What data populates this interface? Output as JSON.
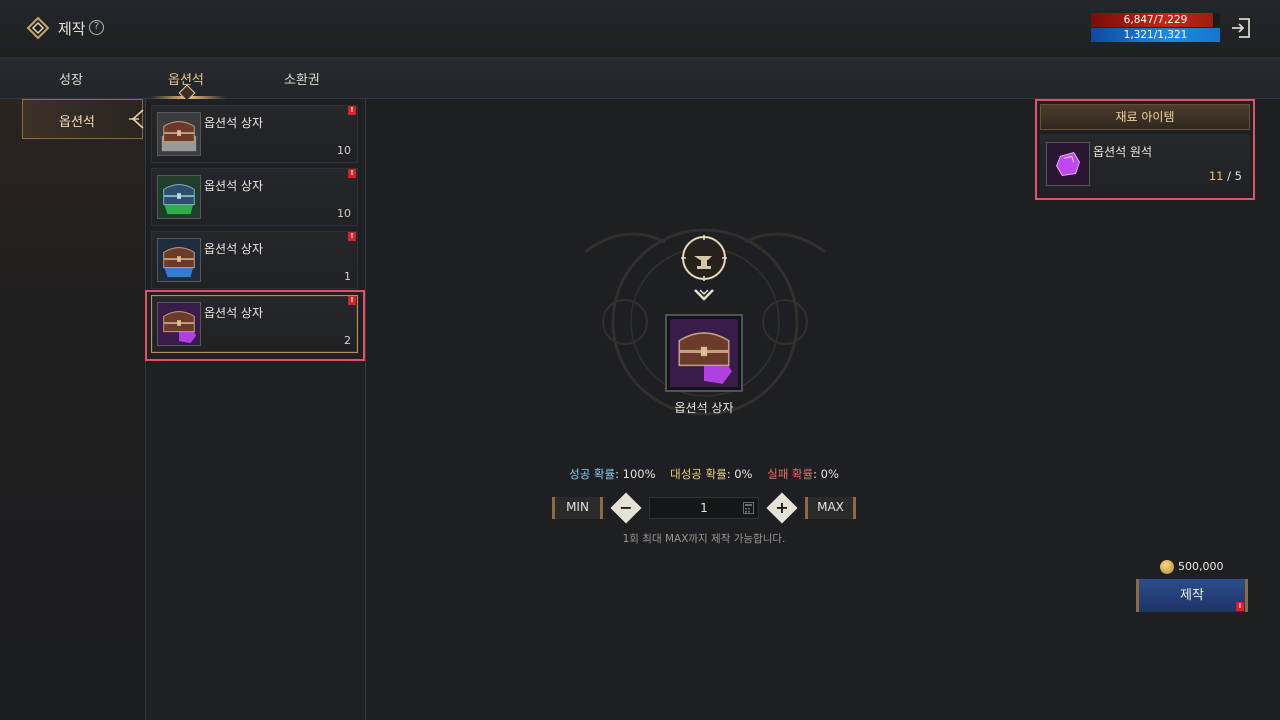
{
  "header": {
    "title": "제작",
    "help_glyph": "?",
    "hp_text": "6,847/7,229",
    "hp_fraction": 0.947,
    "mp_text": "1,321/1,321",
    "mp_fraction": 1.0,
    "icons": [
      "back-diamond-icon",
      "help-icon",
      "exit-icon"
    ]
  },
  "tabs": [
    {
      "label": "성장",
      "active": false
    },
    {
      "label": "옵션석",
      "active": true
    },
    {
      "label": "소환권",
      "active": false
    }
  ],
  "category": {
    "label": "옵션석",
    "selected": true
  },
  "list": {
    "items": [
      {
        "name": "옵션석 상자",
        "count": "10",
        "icon": "chest-gray-icon",
        "badge": "!",
        "selected": false
      },
      {
        "name": "옵션석 상자",
        "count": "10",
        "icon": "chest-green-icon",
        "badge": "!",
        "selected": false
      },
      {
        "name": "옵션석 상자",
        "count": "1",
        "icon": "chest-blue-icon",
        "badge": "!",
        "selected": false
      },
      {
        "name": "옵션석 상자",
        "count": "2",
        "icon": "chest-purple-icon",
        "badge": "!",
        "selected": true
      }
    ]
  },
  "craft": {
    "result_name": "옵션석 상자",
    "success_label": "성공 확률",
    "success_value": ": 100%",
    "great_label": "대성공 확률",
    "great_value": ": 0%",
    "fail_label": "실패 확률",
    "fail_value": ": 0%",
    "min_label": "MIN",
    "max_label": "MAX",
    "decrease_glyph": "−",
    "increase_glyph": "+",
    "quantity": "1",
    "hint": "1회 최대 MAX까지 제작 가능합니다.",
    "cost": "500,000",
    "button_label": "제작",
    "button_badge": "!"
  },
  "materials": {
    "header": "재료 아이템",
    "item_name": "옵션석 원석",
    "have": "11",
    "separator": " / ",
    "need": "5"
  },
  "colors": {
    "accent_gold": "#f1c067",
    "alert_red": "#d4232a",
    "highlight_outline": "#e0526a",
    "success_blue": "#8ec8e8",
    "great_yellow": "#e6cf7a",
    "fail_red": "#e86a6a"
  }
}
